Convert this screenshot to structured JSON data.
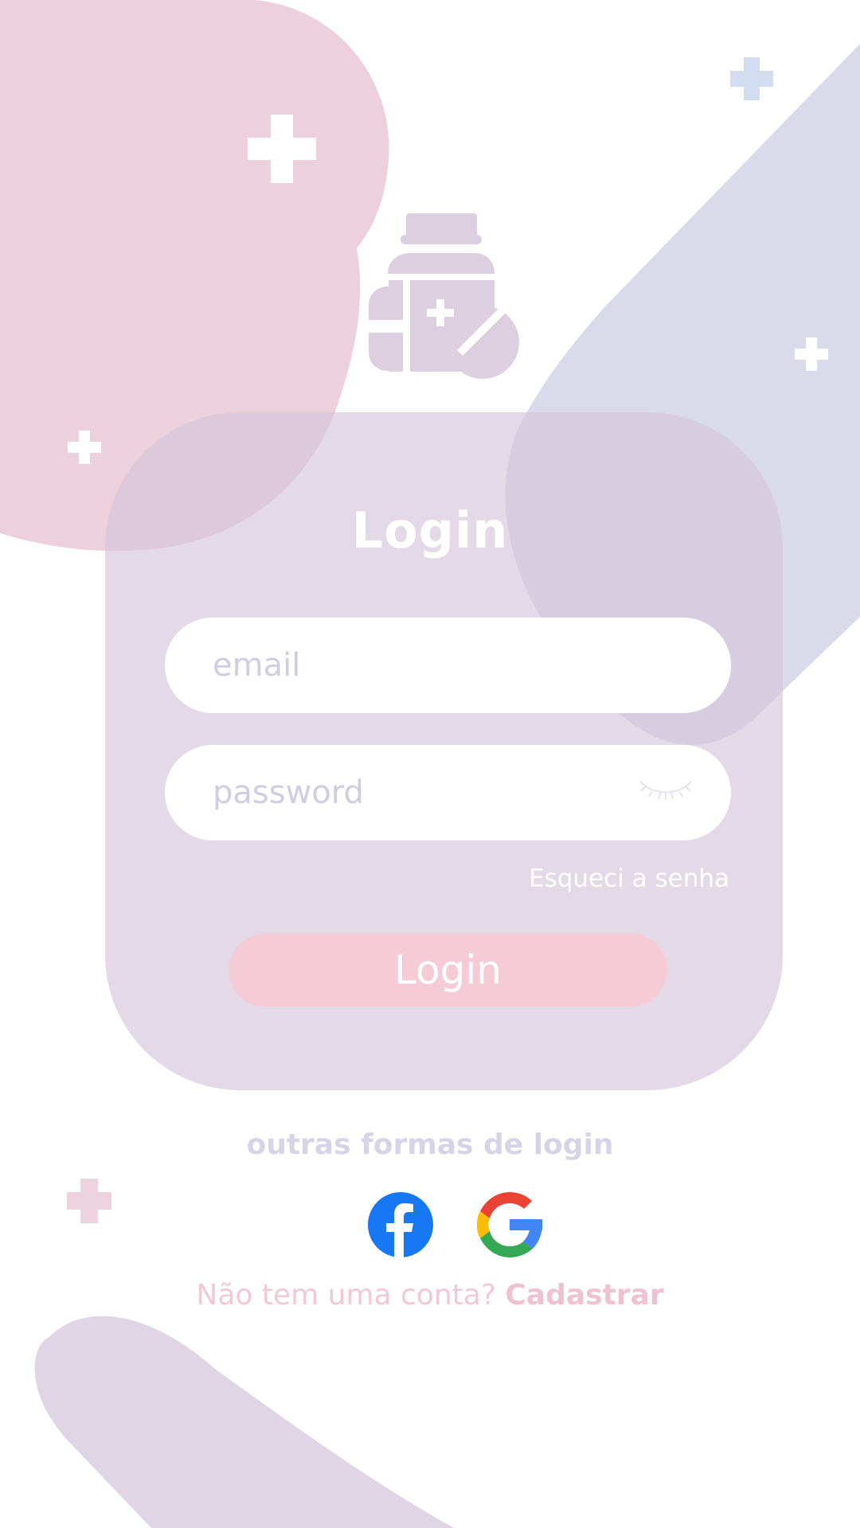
{
  "title": "Login",
  "email": {
    "placeholder": "email",
    "value": ""
  },
  "password": {
    "placeholder": "password",
    "value": ""
  },
  "forgot_label": "Esqueci a senha",
  "login_button_label": "Login",
  "other_login_title": "outras formas de login",
  "social": [
    {
      "name": "facebook",
      "icon": "facebook-icon",
      "color": "#1877f2"
    },
    {
      "name": "google",
      "icon": "google-icon"
    }
  ],
  "signup": {
    "prompt": "Não tem uma conta?",
    "link": "Cadastrar"
  },
  "icons": {
    "app_logo": "medicine-bottle-icon",
    "toggle_password": "eye-closed-icon"
  },
  "colors": {
    "pink_blob": "#ecd0db",
    "lavender_blob": "#dadbea",
    "card": "#e3d9e6",
    "primary_button": "#f5ccd6",
    "placeholder": "#cfcde2",
    "accent_text": "#efc2cf"
  }
}
